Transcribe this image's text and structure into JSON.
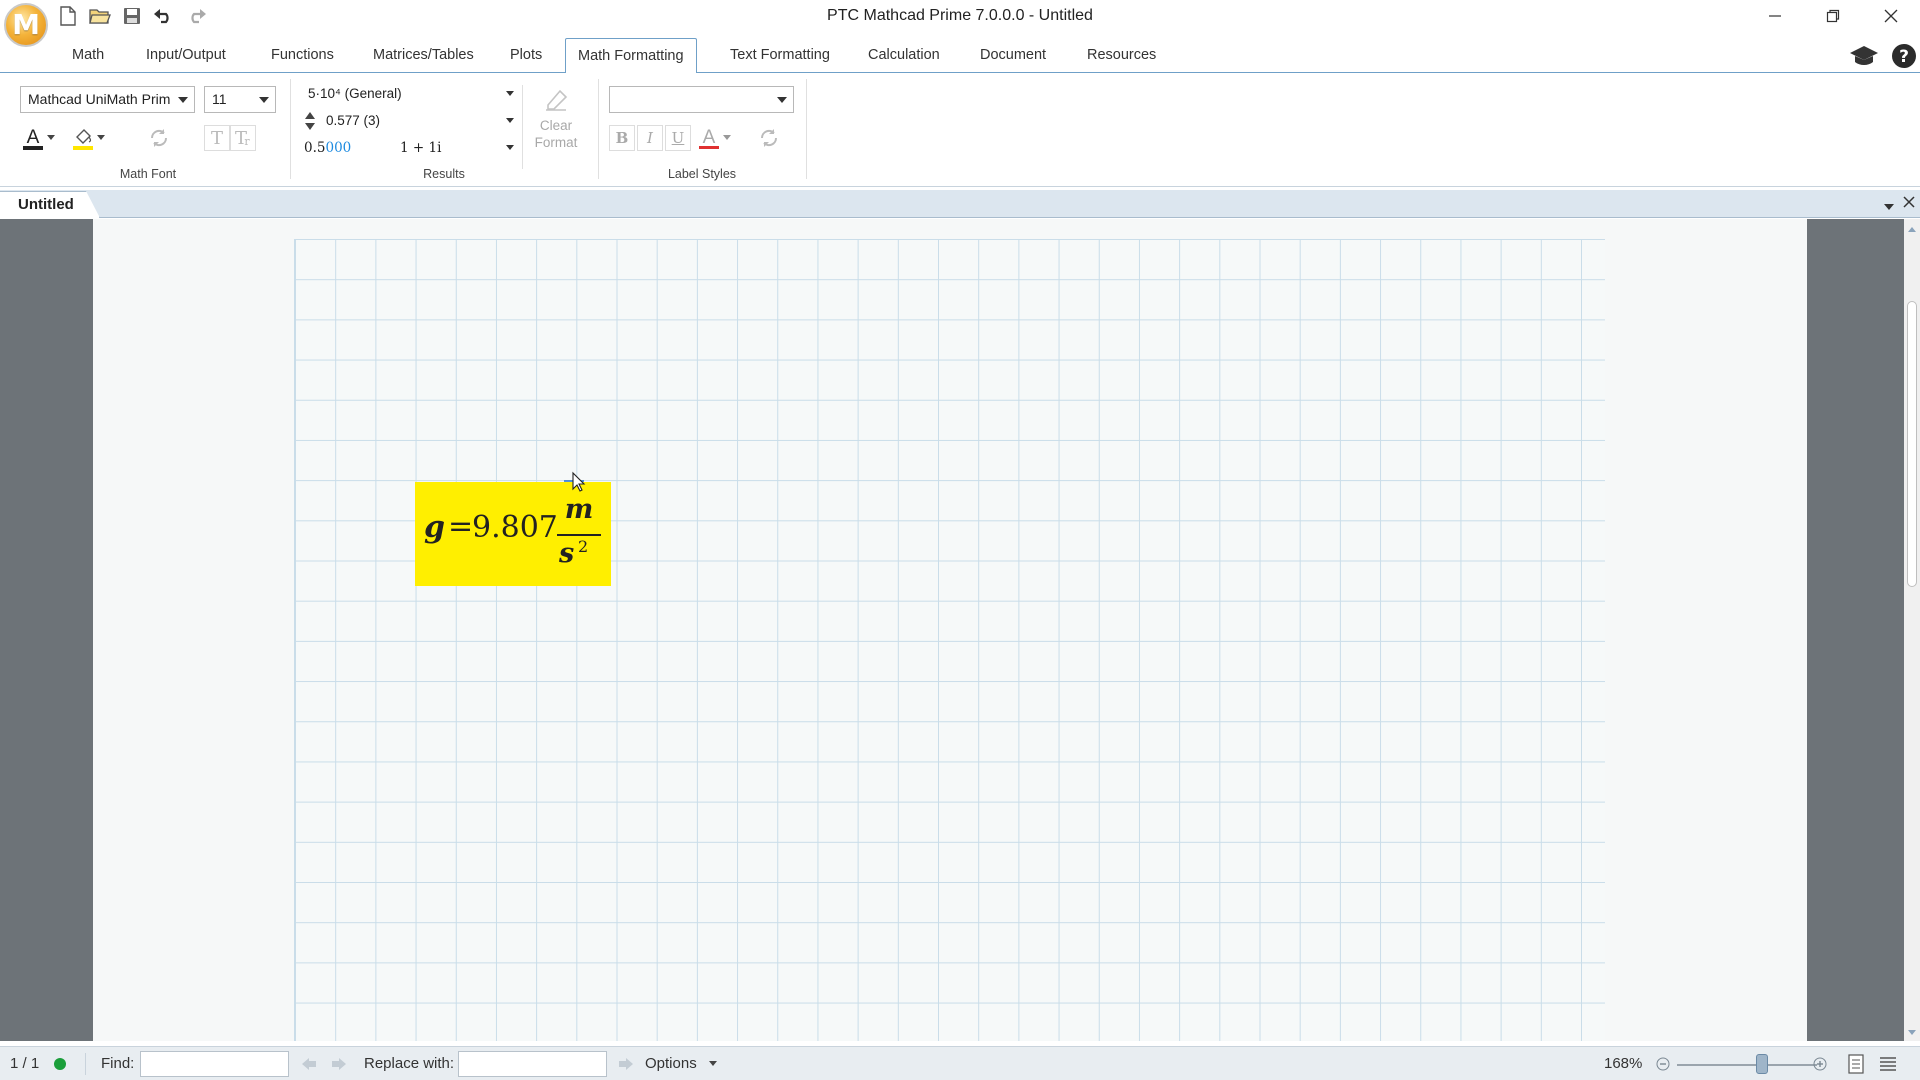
{
  "app": {
    "logo_letter": "M",
    "window_title": "PTC Mathcad Prime 7.0.0.0 - Untitled"
  },
  "ribbon_tabs": [
    {
      "label": "Math"
    },
    {
      "label": "Input/Output"
    },
    {
      "label": "Functions"
    },
    {
      "label": "Matrices/Tables"
    },
    {
      "label": "Plots"
    },
    {
      "label": "Math Formatting",
      "active": true
    },
    {
      "label": "Text Formatting"
    },
    {
      "label": "Calculation"
    },
    {
      "label": "Document"
    },
    {
      "label": "Resources"
    }
  ],
  "math_font": {
    "font_name": "Mathcad UniMath Prim",
    "font_size": "11",
    "group_label": "Math Font"
  },
  "results": {
    "format_general": "5·10⁴ (General)",
    "decimal_places": "0.577 (3)",
    "trailing_zeros_a": "0.5",
    "trailing_zeros_b": "000",
    "complex_format": "1 + 1i",
    "clear_format_line1": "Clear",
    "clear_format_line2": "Format",
    "group_label": "Results"
  },
  "label_styles": {
    "style_value": "",
    "bold": "B",
    "italic": "I",
    "underline": "U",
    "font_color": "A",
    "group_label": "Label Styles"
  },
  "document": {
    "tab_label": "Untitled",
    "equation": {
      "variable": "g",
      "operator": "=",
      "value": "9.807",
      "unit_numerator": "m",
      "unit_denominator": "s",
      "unit_exponent": "2",
      "highlight_color": "#ffef00"
    }
  },
  "statusbar": {
    "page_indicator": "1 / 1",
    "find_label": "Find:",
    "find_value": "",
    "replace_label": "Replace with:",
    "replace_value": "",
    "options_label": "Options",
    "zoom_level": "168%"
  },
  "colors": {
    "accent_blue": "#6fa0c8",
    "status_ok": "#1a9e3a",
    "font_color_bar": "#222222",
    "highlight_bar": "#ffe600",
    "label_color_bar": "#e03030"
  }
}
